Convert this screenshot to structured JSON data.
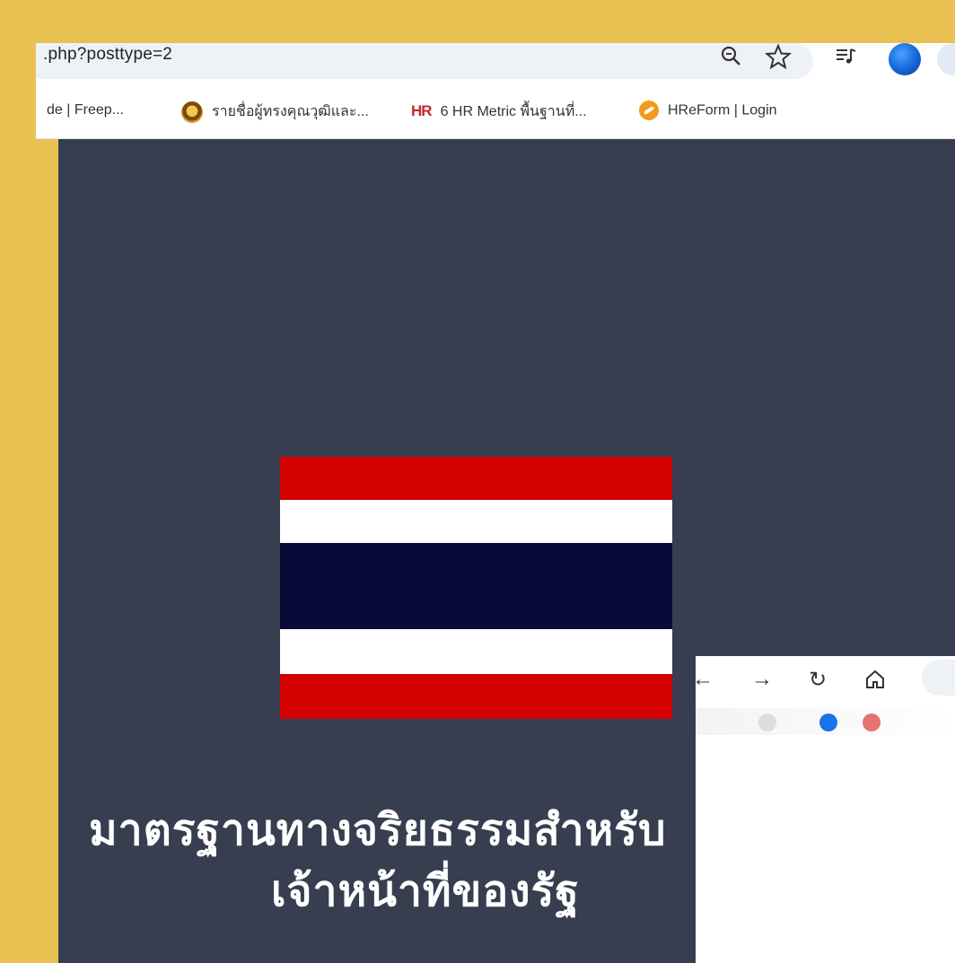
{
  "browser": {
    "url": ".php?posttype=2",
    "bookmarks": [
      {
        "label": "de | Freep..."
      },
      {
        "label": "รายชื่อผู้ทรงคุณวุฒิและ..."
      },
      {
        "icon_text": "HR",
        "label": "6 HR Metric พื้นฐานที่..."
      },
      {
        "label": "HReForm | Login"
      }
    ]
  },
  "content": {
    "heading_line1": "มาตรฐานทางจริยธรรมสำหรับ",
    "heading_line2": "เจ้าหน้าที่ของรัฐ"
  },
  "colors": {
    "frame": "#E9C152",
    "content_bg": "#363E50",
    "flag_red": "#D40000",
    "flag_white": "#FFFFFF",
    "flag_blue": "#0A0A3A"
  },
  "icons": {
    "zoom": "zoom-icon",
    "bookmark_star": "star-icon",
    "media": "media-control-icon",
    "profile": "avatar",
    "back": "back-arrow-icon",
    "forward": "forward-arrow-icon",
    "reload": "reload-icon",
    "home": "home-icon"
  }
}
